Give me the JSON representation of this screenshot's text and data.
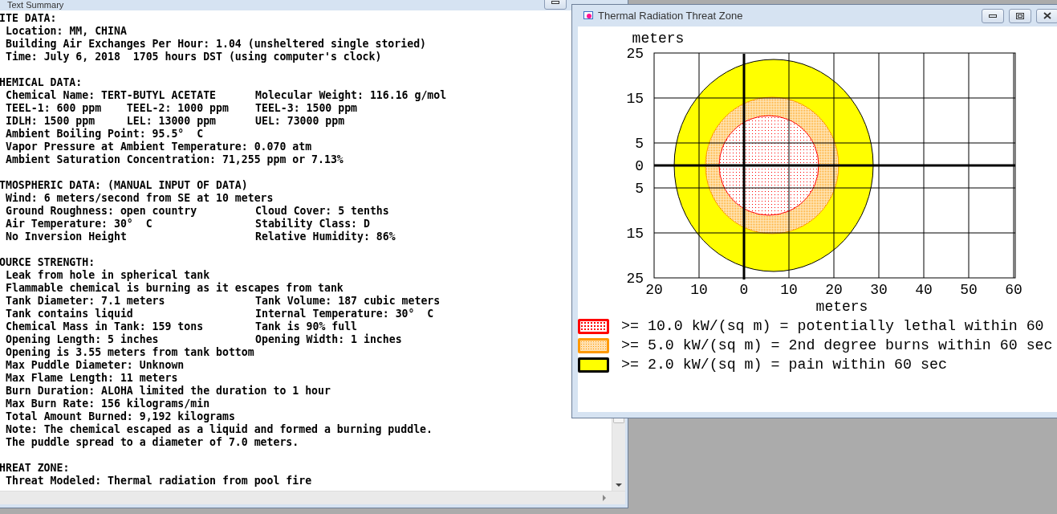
{
  "text_window": {
    "title": "Text Summary",
    "sections": [
      {
        "heading": "ITE DATA:",
        "lines": [
          {
            "text": "Location: MM, CHINA"
          },
          {
            "text": "Building Air Exchanges Per Hour: 1.04 (unsheltered single storied)"
          },
          {
            "text": "Time: July 6, 2018  1705 hours DST (using computer's clock)"
          }
        ]
      },
      {
        "heading": "HEMICAL DATA:",
        "lines": [
          {
            "text": "Chemical Name: TERT-BUTYL ACETATE",
            "text_2": "Molecular Weight: 116.16 g/mol"
          },
          {
            "text": "TEEL-1: 600 ppm    TEEL-2: 1000 ppm",
            "text_2": "TEEL-3: 1500 ppm"
          },
          {
            "text": "IDLH: 1500 ppm     LEL: 13000 ppm",
            "text_2": "UEL: 73000 ppm"
          },
          {
            "text": "Ambient Boiling Point: 95.5°  C"
          },
          {
            "text": "Vapor Pressure at Ambient Temperature: 0.070 atm"
          },
          {
            "text": "Ambient Saturation Concentration: 71,255 ppm or 7.13%"
          }
        ]
      },
      {
        "heading": "TMOSPHERIC DATA: (MANUAL INPUT OF DATA)",
        "lines": [
          {
            "text": "Wind: 6 meters/second from SE at 10 meters"
          },
          {
            "text": "Ground Roughness: open country",
            "text_2": "Cloud Cover: 5 tenths"
          },
          {
            "text": "Air Temperature: 30°  C",
            "text_2": "Stability Class: D"
          },
          {
            "text": "No Inversion Height",
            "text_2": "Relative Humidity: 86%"
          }
        ]
      },
      {
        "heading": "OURCE STRENGTH:",
        "lines": [
          {
            "text": "Leak from hole in spherical tank"
          },
          {
            "text": "Flammable chemical is burning as it escapes from tank"
          },
          {
            "text": "Tank Diameter: 7.1 meters",
            "text_2": "Tank Volume: 187 cubic meters"
          },
          {
            "text": "Tank contains liquid",
            "text_2": "Internal Temperature: 30°  C"
          },
          {
            "text": "Chemical Mass in Tank: 159 tons",
            "text_2": "Tank is 90% full"
          },
          {
            "text": "Opening Length: 5 inches",
            "text_2": "Opening Width: 1 inches"
          },
          {
            "text": "Opening is 3.55 meters from tank bottom"
          },
          {
            "text": "Max Puddle Diameter: Unknown"
          },
          {
            "text": "Max Flame Length: 11 meters"
          },
          {
            "text": "Burn Duration: ALOHA limited the duration to 1 hour"
          },
          {
            "text": "Max Burn Rate: 156 kilograms/min"
          },
          {
            "text": "Total Amount Burned: 9,192 kilograms"
          },
          {
            "text": "Note: The chemical escaped as a liquid and formed a burning puddle."
          },
          {
            "text": "The puddle spread to a diameter of 7.0 meters."
          }
        ]
      },
      {
        "heading": "HREAT ZONE:",
        "lines": [
          {
            "text": "Threat Modeled: Thermal radiation from pool fire"
          }
        ]
      }
    ]
  },
  "zone_window": {
    "title": "Thermal Radiation Threat Zone",
    "chart": {
      "ylabel": "meters",
      "yticks": [
        "25",
        "15",
        "5",
        "0",
        "5",
        "15",
        "25"
      ],
      "xticks": [
        "20",
        "10",
        "0",
        "10",
        "20",
        "30",
        "40",
        "50",
        "60"
      ],
      "xlabel": "meters"
    },
    "legend": [
      {
        "kind": "lethal",
        "color": "#ff0000",
        "text": ">= 10.0 kW/(sq m) = potentially lethal within 60"
      },
      {
        "kind": "burns",
        "color": "#ff9900",
        "text": ">= 5.0 kW/(sq m) = 2nd degree burns within 60 sec"
      },
      {
        "kind": "pain",
        "color": "#000000",
        "text": ">= 2.0 kW/(sq m) = pain within 60 sec"
      }
    ]
  }
}
